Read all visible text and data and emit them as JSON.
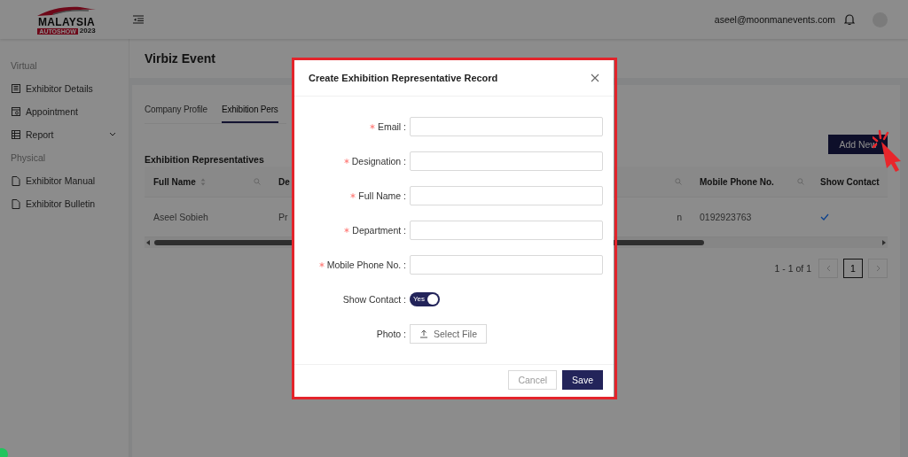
{
  "logo": {
    "title": "MALAYSIA",
    "badge": "AUTOSHOW",
    "year": "2023"
  },
  "header": {
    "user_email": "aseel@moonmanevents.com"
  },
  "sidebar": {
    "groups": [
      {
        "label": "Virtual",
        "items": [
          {
            "label": "Exhibitor Details",
            "kind": "details",
            "expandable": false
          },
          {
            "label": "Appointment",
            "kind": "calendar",
            "expandable": false
          },
          {
            "label": "Report",
            "kind": "table",
            "expandable": true
          }
        ]
      },
      {
        "label": "Physical",
        "items": [
          {
            "label": "Exhibitor Manual",
            "kind": "document",
            "expandable": false
          },
          {
            "label": "Exhibitor Bulletin",
            "kind": "document",
            "expandable": false
          }
        ]
      }
    ]
  },
  "page": {
    "title": "Virbiz Event"
  },
  "tabs": [
    {
      "label": "Company Profile",
      "selected": false
    },
    {
      "label": "Exhibition Pers",
      "selected": true
    }
  ],
  "section": {
    "title": "Exhibition Representatives",
    "add_button": "Add New"
  },
  "table": {
    "columns": [
      {
        "label": "Full Name",
        "sortable": true,
        "searchable": true
      },
      {
        "label": "De"
      },
      {
        "sortable": false,
        "searchable": true
      },
      {
        "label": "Mobile Phone No.",
        "sortable": false,
        "searchable": true
      },
      {
        "label": "Show Contact"
      }
    ],
    "rows": [
      {
        "cells": [
          "Aseel Sobieh",
          "Pr",
          "n",
          "0192923763"
        ],
        "show_contact": true
      }
    ]
  },
  "pagination": {
    "summary": "1 - 1 of 1",
    "pages": [
      {
        "label": "1",
        "selected": true
      }
    ]
  },
  "modal": {
    "title": "Create Exhibition Representative Record",
    "fields": [
      {
        "kind": "text",
        "label": "Email :",
        "required": true
      },
      {
        "kind": "text",
        "label": "Designation :",
        "required": true
      },
      {
        "kind": "text",
        "label": "Full Name :",
        "required": true
      },
      {
        "kind": "text",
        "label": "Department :",
        "required": true
      },
      {
        "kind": "text",
        "label": "Mobile Phone No. :",
        "required": true
      },
      {
        "kind": "switch",
        "label": "Show Contact :",
        "on": true,
        "on_text": "Yes"
      },
      {
        "kind": "upload",
        "label": "Photo :",
        "button": "Select File"
      }
    ],
    "buttons": [
      {
        "label": "Cancel",
        "kind": "default"
      },
      {
        "label": "Save",
        "kind": "primary"
      }
    ]
  }
}
